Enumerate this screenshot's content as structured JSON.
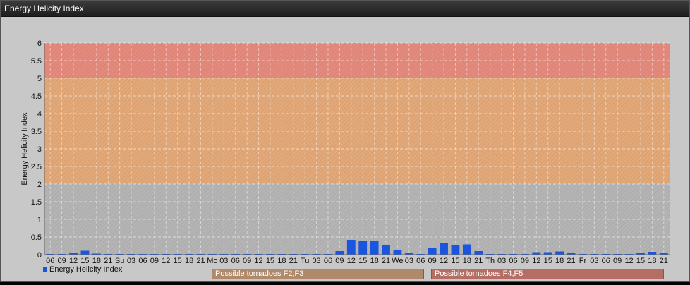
{
  "window": {
    "title": "Energy Helicity Index"
  },
  "chart_data": {
    "type": "bar",
    "title": "",
    "ylabel": "Energy Helicity Index",
    "xlabel": "",
    "ylim": [
      0,
      6
    ],
    "yticks": [
      "0",
      "0.5",
      "1",
      "1.5",
      "2",
      "2.5",
      "3",
      "3.5",
      "4",
      "4.5",
      "5",
      "5.5",
      "6"
    ],
    "grid": true,
    "bands": [
      {
        "from": 0,
        "to": 2,
        "color": "#b4b4b4"
      },
      {
        "from": 2,
        "to": 5,
        "color": "#e2a878"
      },
      {
        "from": 5,
        "to": 6,
        "color": "#e48a7c"
      }
    ],
    "categories": [
      "06",
      "09",
      "12",
      "15",
      "18",
      "21",
      "Su",
      "03",
      "06",
      "09",
      "12",
      "15",
      "18",
      "21",
      "Mo",
      "03",
      "06",
      "09",
      "12",
      "15",
      "18",
      "21",
      "Tu",
      "03",
      "06",
      "09",
      "12",
      "15",
      "18",
      "21",
      "We",
      "03",
      "06",
      "09",
      "12",
      "15",
      "18",
      "21",
      "Th",
      "03",
      "06",
      "09",
      "12",
      "15",
      "18",
      "21",
      "Fr",
      "03",
      "06",
      "09",
      "12",
      "15",
      "18",
      "21"
    ],
    "series": [
      {
        "name": "Energy Helicity Index",
        "color": "#1a55e0",
        "values": [
          0.02,
          0.02,
          0.04,
          0.11,
          0.03,
          0.02,
          0.02,
          0.02,
          0.02,
          0.02,
          0.02,
          0.02,
          0.02,
          0.02,
          0.02,
          0.02,
          0.02,
          0.02,
          0.02,
          0.02,
          0.02,
          0.02,
          0.02,
          0.02,
          0.02,
          0.1,
          0.42,
          0.38,
          0.39,
          0.28,
          0.14,
          0.04,
          0.02,
          0.18,
          0.33,
          0.28,
          0.29,
          0.1,
          0.02,
          0.02,
          0.02,
          0.02,
          0.07,
          0.07,
          0.09,
          0.05,
          0.02,
          0.02,
          0.02,
          0.02,
          0.02,
          0.06,
          0.08,
          0.04
        ]
      }
    ],
    "legend": [
      {
        "label": "Energy Helicity Index",
        "color": "#1a55e0"
      },
      {
        "label": "Possible tornadoes F2,F3",
        "color": "#b0896b"
      },
      {
        "label": "Possible tornadoes F4,F5",
        "color": "#b46e63"
      }
    ]
  }
}
